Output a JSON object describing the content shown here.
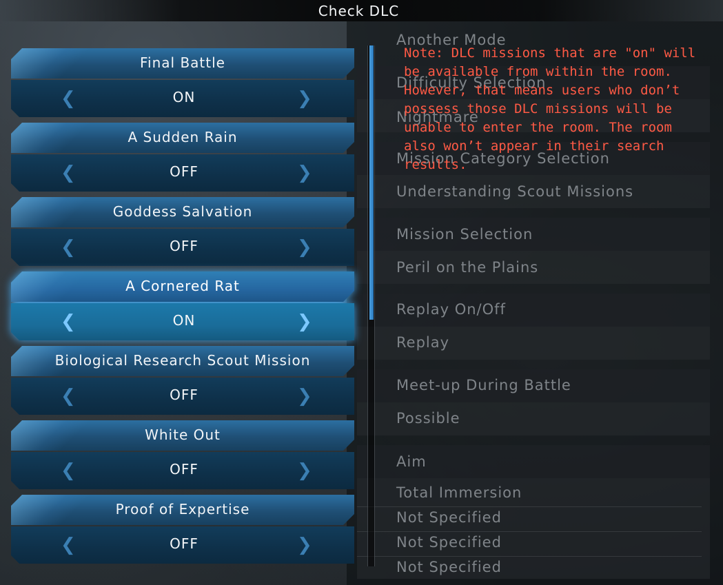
{
  "title": "Check DLC",
  "note": "Note: DLC missions that are \"on\" will be available from within the room. However, that means users who don’t possess those DLC missions will be unable to enter the room. The room also won’t appear in their search results.",
  "dlc_items": [
    {
      "name": "Final Battle",
      "value": "ON"
    },
    {
      "name": "A Sudden Rain",
      "value": "OFF"
    },
    {
      "name": "Goddess Salvation",
      "value": "OFF"
    },
    {
      "name": "A Cornered Rat",
      "value": "ON"
    },
    {
      "name": "Biological Research Scout Mission",
      "value": "OFF"
    },
    {
      "name": "White Out",
      "value": "OFF"
    },
    {
      "name": "Proof of Expertise",
      "value": "OFF"
    }
  ],
  "background_settings": {
    "another_mode_label": "Another Mode",
    "difficulty_label": "Difficulty Selection",
    "difficulty_value": "Nightmare",
    "mission_category_label": "Mission Category Selection",
    "mission_category_value": "Understanding Scout Missions",
    "mission_selection_label": "Mission Selection",
    "mission_selection_value": "Peril on the Plains",
    "replay_label": "Replay On/Off",
    "replay_value": "Replay",
    "meetup_label": "Meet-up During Battle",
    "meetup_value": "Possible",
    "aim_label": "Aim",
    "aim_values": [
      "Total Immersion",
      "Not Specified",
      "Not Specified",
      "Not Specified"
    ]
  },
  "arrow_left": "❮",
  "arrow_right": "❯",
  "colors": {
    "note": "#ff5a45",
    "selected_glow": "#46aaf0",
    "accent": "#2c6fa1"
  }
}
